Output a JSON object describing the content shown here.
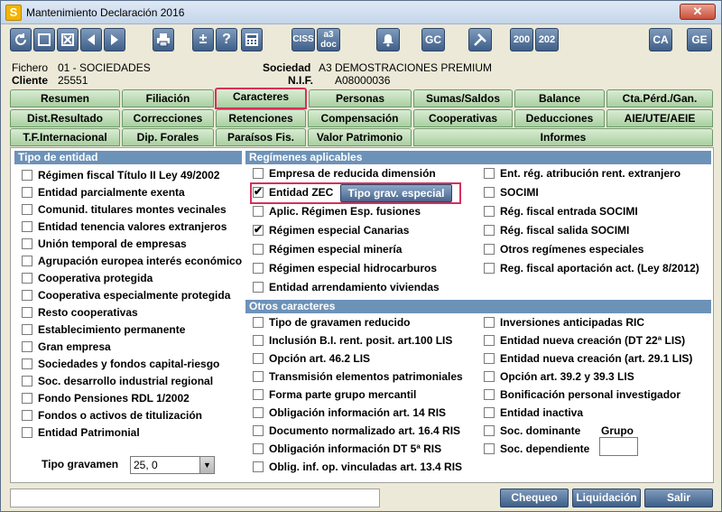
{
  "window": {
    "title": "Mantenimiento Declaración 2016",
    "app_icon_letter": "S",
    "close_label": "✕"
  },
  "toolbar": {
    "buttons": [
      {
        "name": "refresh-icon",
        "label": ""
      },
      {
        "name": "square-icon",
        "label": ""
      },
      {
        "name": "cross-box-icon",
        "label": ""
      },
      {
        "name": "arrow-left-icon",
        "label": ""
      },
      {
        "name": "arrow-right-icon",
        "label": ""
      },
      {
        "name": "printer-icon",
        "label": ""
      },
      {
        "name": "plus-minus-icon",
        "label": "±"
      },
      {
        "name": "help-icon",
        "label": "?"
      },
      {
        "name": "calculator-icon",
        "label": ""
      },
      {
        "name": "ciss",
        "label": "CISS"
      },
      {
        "name": "a3doc",
        "label": "a3 doc"
      },
      {
        "name": "bell-icon",
        "label": ""
      },
      {
        "name": "gc",
        "label": "GC"
      },
      {
        "name": "tools-icon",
        "label": ""
      },
      {
        "name": "m200",
        "label": "200"
      },
      {
        "name": "m202",
        "label": "202"
      },
      {
        "name": "ca",
        "label": "CA"
      },
      {
        "name": "ge",
        "label": "GE"
      }
    ]
  },
  "header": {
    "fichero_label": "Fichero",
    "fichero_value": "01 - SOCIEDADES",
    "cliente_label": "Cliente",
    "cliente_value": "25551",
    "sociedad_label": "Sociedad",
    "sociedad_value": "A3 DEMOSTRACIONES PREMIUM",
    "nif_label": "N.I.F.",
    "nif_value": "A08000036"
  },
  "tabs": {
    "row1": [
      "Resumen",
      "Filiación",
      "Caracteres",
      "Personas",
      "Sumas/Saldos",
      "Balance",
      "Cta.Pérd./Gan."
    ],
    "row2": [
      "Dist.Resultado",
      "Correcciones",
      "Retenciones",
      "Compensación",
      "Cooperativas",
      "Deducciones",
      "AIE/UTE/AEIE"
    ],
    "row3": [
      "T.F.Internacional",
      "Dip. Forales",
      "Paraísos Fis.",
      "Valor Patrimonio",
      "Informes"
    ],
    "active": "Caracteres"
  },
  "tipo_entidad": {
    "title": "Tipo de entidad",
    "items": [
      {
        "label": "Régimen fiscal Título II Ley 49/2002",
        "checked": false
      },
      {
        "label": "Entidad parcialmente exenta",
        "checked": false
      },
      {
        "label": "Comunid. titulares montes vecinales",
        "checked": false
      },
      {
        "label": "Entidad tenencia valores extranjeros",
        "checked": false
      },
      {
        "label": "Unión temporal de empresas",
        "checked": false
      },
      {
        "label": "Agrupación europea interés económico",
        "checked": false
      },
      {
        "label": "Cooperativa protegida",
        "checked": false
      },
      {
        "label": "Cooperativa especialmente protegida",
        "checked": false
      },
      {
        "label": "Resto cooperativas",
        "checked": false
      },
      {
        "label": "Establecimiento permanente",
        "checked": false
      },
      {
        "label": "Gran empresa",
        "checked": false
      },
      {
        "label": "Sociedades y fondos capital-riesgo",
        "checked": false
      },
      {
        "label": "Soc. desarrollo industrial regional",
        "checked": false
      },
      {
        "label": "Fondo Pensiones RDL 1/2002",
        "checked": false
      },
      {
        "label": "Fondos o activos de titulización",
        "checked": false
      },
      {
        "label": "Entidad Patrimonial",
        "checked": false
      }
    ],
    "tipo_gravamen_label": "Tipo gravamen",
    "tipo_gravamen_value": "25, 0"
  },
  "regimenes": {
    "title": "Regímenes aplicables",
    "left": [
      {
        "label": "Empresa de reducida dimensión",
        "checked": false
      },
      {
        "label": "Entidad ZEC",
        "checked": true
      },
      {
        "label": "Aplic. Régimen Esp. fusiones",
        "checked": false
      },
      {
        "label": "Régimen especial Canarias",
        "checked": true
      },
      {
        "label": "Régimen especial minería",
        "checked": false
      },
      {
        "label": "Régimen especial hidrocarburos",
        "checked": false
      },
      {
        "label": "Entidad arrendamiento viviendas",
        "checked": false
      }
    ],
    "right": [
      {
        "label": "Ent. rég. atribución rent. extranjero",
        "checked": false
      },
      {
        "label": "SOCIMI",
        "checked": false
      },
      {
        "label": "Rég. fiscal entrada SOCIMI",
        "checked": false
      },
      {
        "label": "Rég. fiscal salida SOCIMI",
        "checked": false
      },
      {
        "label": "Otros regímenes especiales",
        "checked": false
      },
      {
        "label": "Reg. fiscal aportación act. (Ley 8/2012)",
        "checked": false
      }
    ],
    "tipo_grav_button": "Tipo grav. especial"
  },
  "otros": {
    "title": "Otros caracteres",
    "left": [
      {
        "label": "Tipo de gravamen reducido",
        "checked": false
      },
      {
        "label": "Inclusión B.I. rent. posit. art.100 LIS",
        "checked": false
      },
      {
        "label": "Opción art. 46.2 LIS",
        "checked": false
      },
      {
        "label": "Transmisión elementos patrimoniales",
        "checked": false
      },
      {
        "label": "Forma parte grupo mercantil",
        "checked": false
      },
      {
        "label": "Obligación información art. 14 RIS",
        "checked": false
      },
      {
        "label": "Documento normalizado art. 16.4 RIS",
        "checked": false
      },
      {
        "label": "Obligación información DT 5ª RIS",
        "checked": false
      },
      {
        "label": "Oblig. inf. op. vinculadas art. 13.4 RIS",
        "checked": false
      }
    ],
    "right": [
      {
        "label": "Inversiones anticipadas RIC",
        "checked": false
      },
      {
        "label": "Entidad nueva creación  (DT 22ª LIS)",
        "checked": false
      },
      {
        "label": "Entidad nueva creación  (art. 29.1 LIS)",
        "checked": false
      },
      {
        "label": "Opción art. 39.2 y 39.3 LIS",
        "checked": false
      },
      {
        "label": "Bonificación personal investigador",
        "checked": false
      },
      {
        "label": "Entidad inactiva",
        "checked": false
      },
      {
        "label": "Soc. dominante",
        "checked": false
      },
      {
        "label": "Soc. dependiente",
        "checked": false
      }
    ],
    "grupo_label": "Grupo"
  },
  "bottom": {
    "chequeo": "Chequeo",
    "liquidacion": "Liquidación",
    "salir": "Salir"
  }
}
